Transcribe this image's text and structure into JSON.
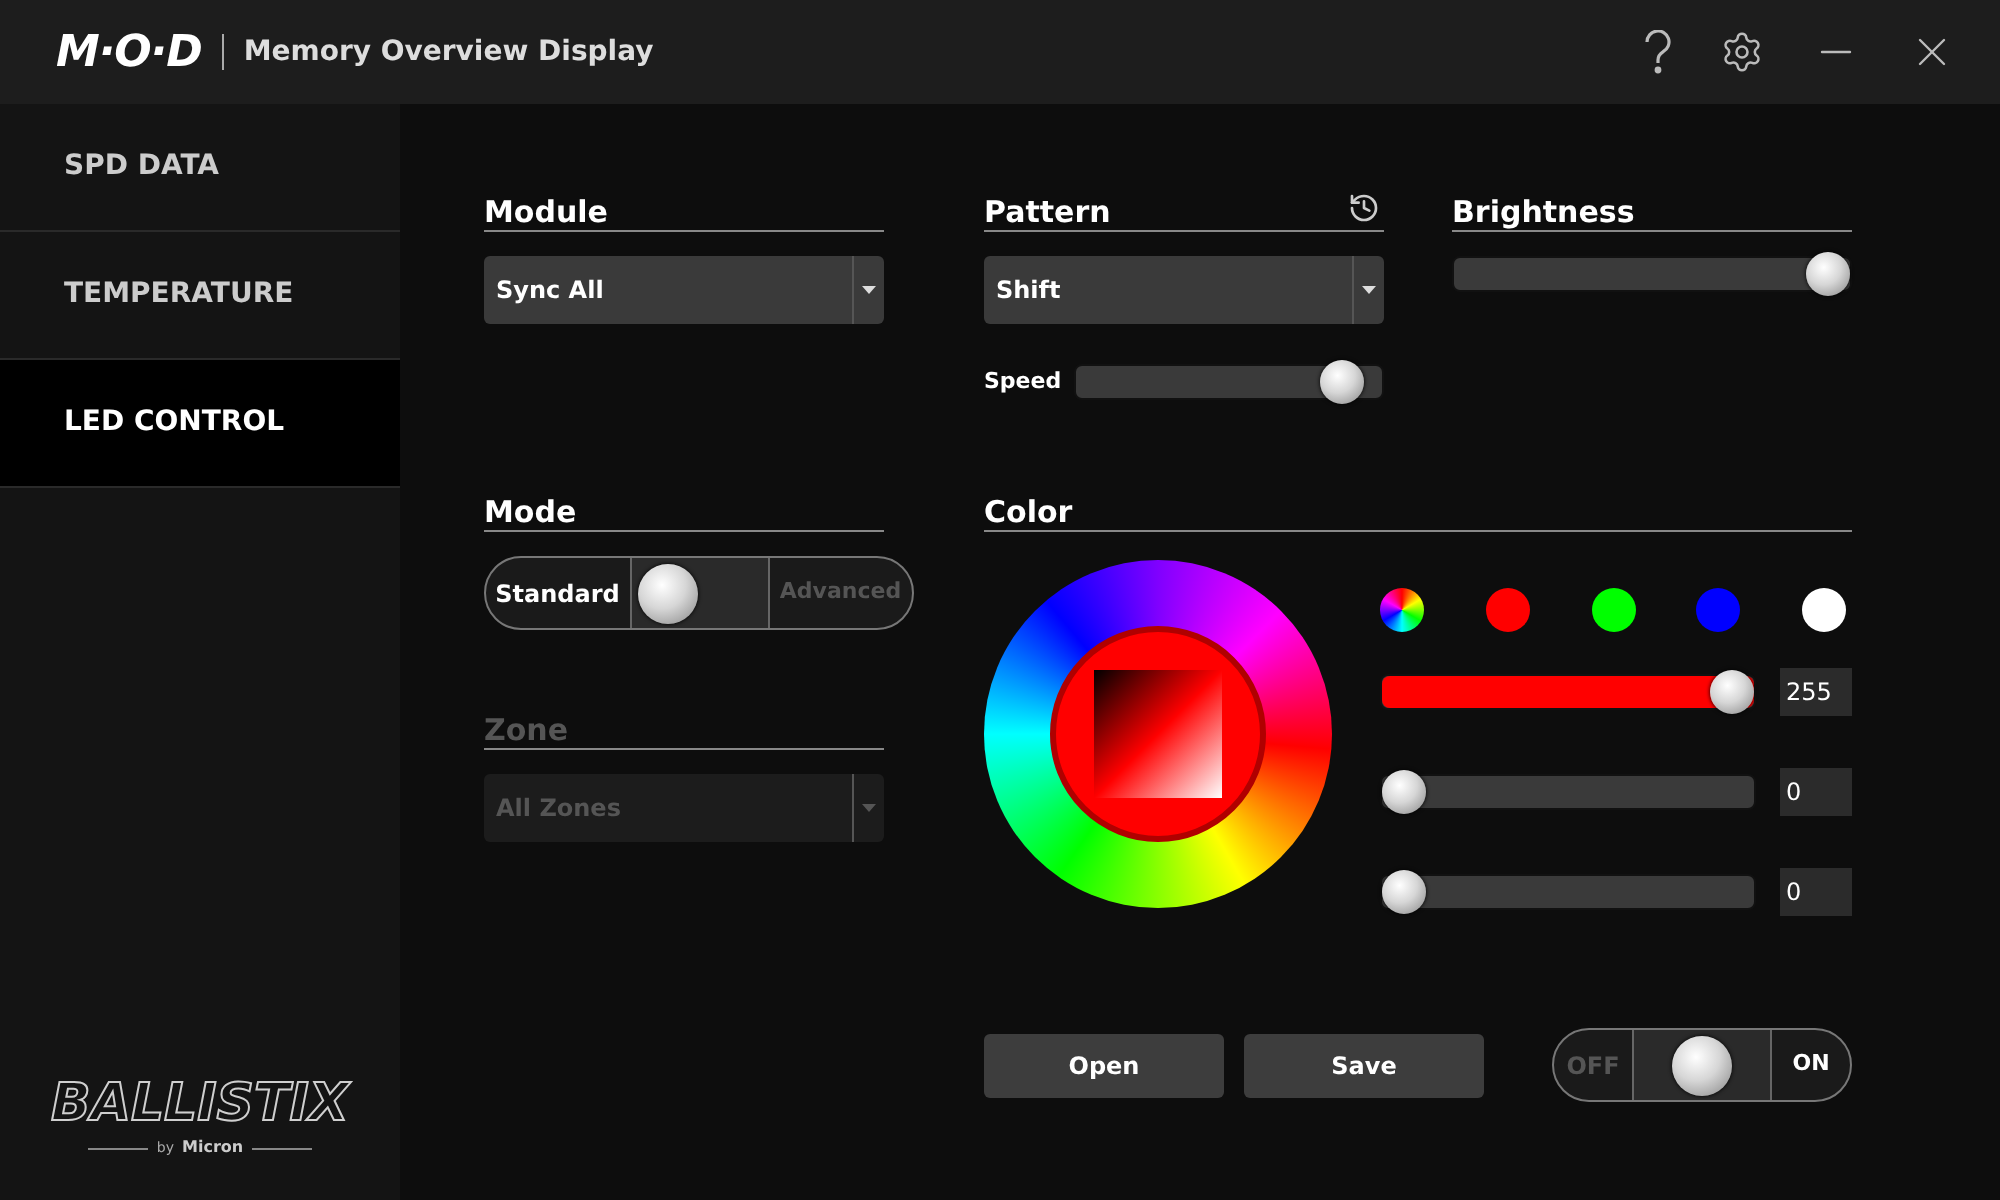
{
  "header": {
    "logo": "M·O·D",
    "title": "Memory Overview Display"
  },
  "sidebar": {
    "items": [
      {
        "label": "SPD DATA",
        "selected": false
      },
      {
        "label": "TEMPERATURE",
        "selected": false
      },
      {
        "label": "LED CONTROL",
        "selected": true
      }
    ]
  },
  "module": {
    "label": "Module",
    "value": "Sync All"
  },
  "pattern": {
    "label": "Pattern",
    "value": "Shift",
    "speed_label": "Speed",
    "speed": {
      "level": 0.93
    }
  },
  "brightness": {
    "label": "Brightness",
    "level": 1
  },
  "mode": {
    "label": "Mode",
    "options": [
      {
        "label": "Standard",
        "selected": true
      },
      {
        "label": "Advanced",
        "selected": false
      }
    ]
  },
  "zone": {
    "label": "Zone",
    "value": "All Zones",
    "disabled": true
  },
  "color": {
    "label": "Color",
    "swatches": [
      {
        "kind": "spectrum"
      },
      {
        "kind": "solid",
        "color": "#ff0000"
      },
      {
        "kind": "solid",
        "color": "#00ff00"
      },
      {
        "kind": "solid",
        "color": "#0000ff"
      },
      {
        "kind": "solid",
        "color": "#ffffff"
      }
    ],
    "channels": [
      {
        "level": 1,
        "reading": "255"
      },
      {
        "level": 0,
        "reading": "0"
      },
      {
        "level": 0,
        "reading": "0"
      }
    ]
  },
  "buttons": [
    "Open",
    "Save"
  ],
  "power": {
    "off_label": "OFF",
    "on_label": "ON",
    "on": true
  },
  "brand": {
    "name": "BALLISTIX",
    "byline": "by",
    "maker": "Micron"
  }
}
